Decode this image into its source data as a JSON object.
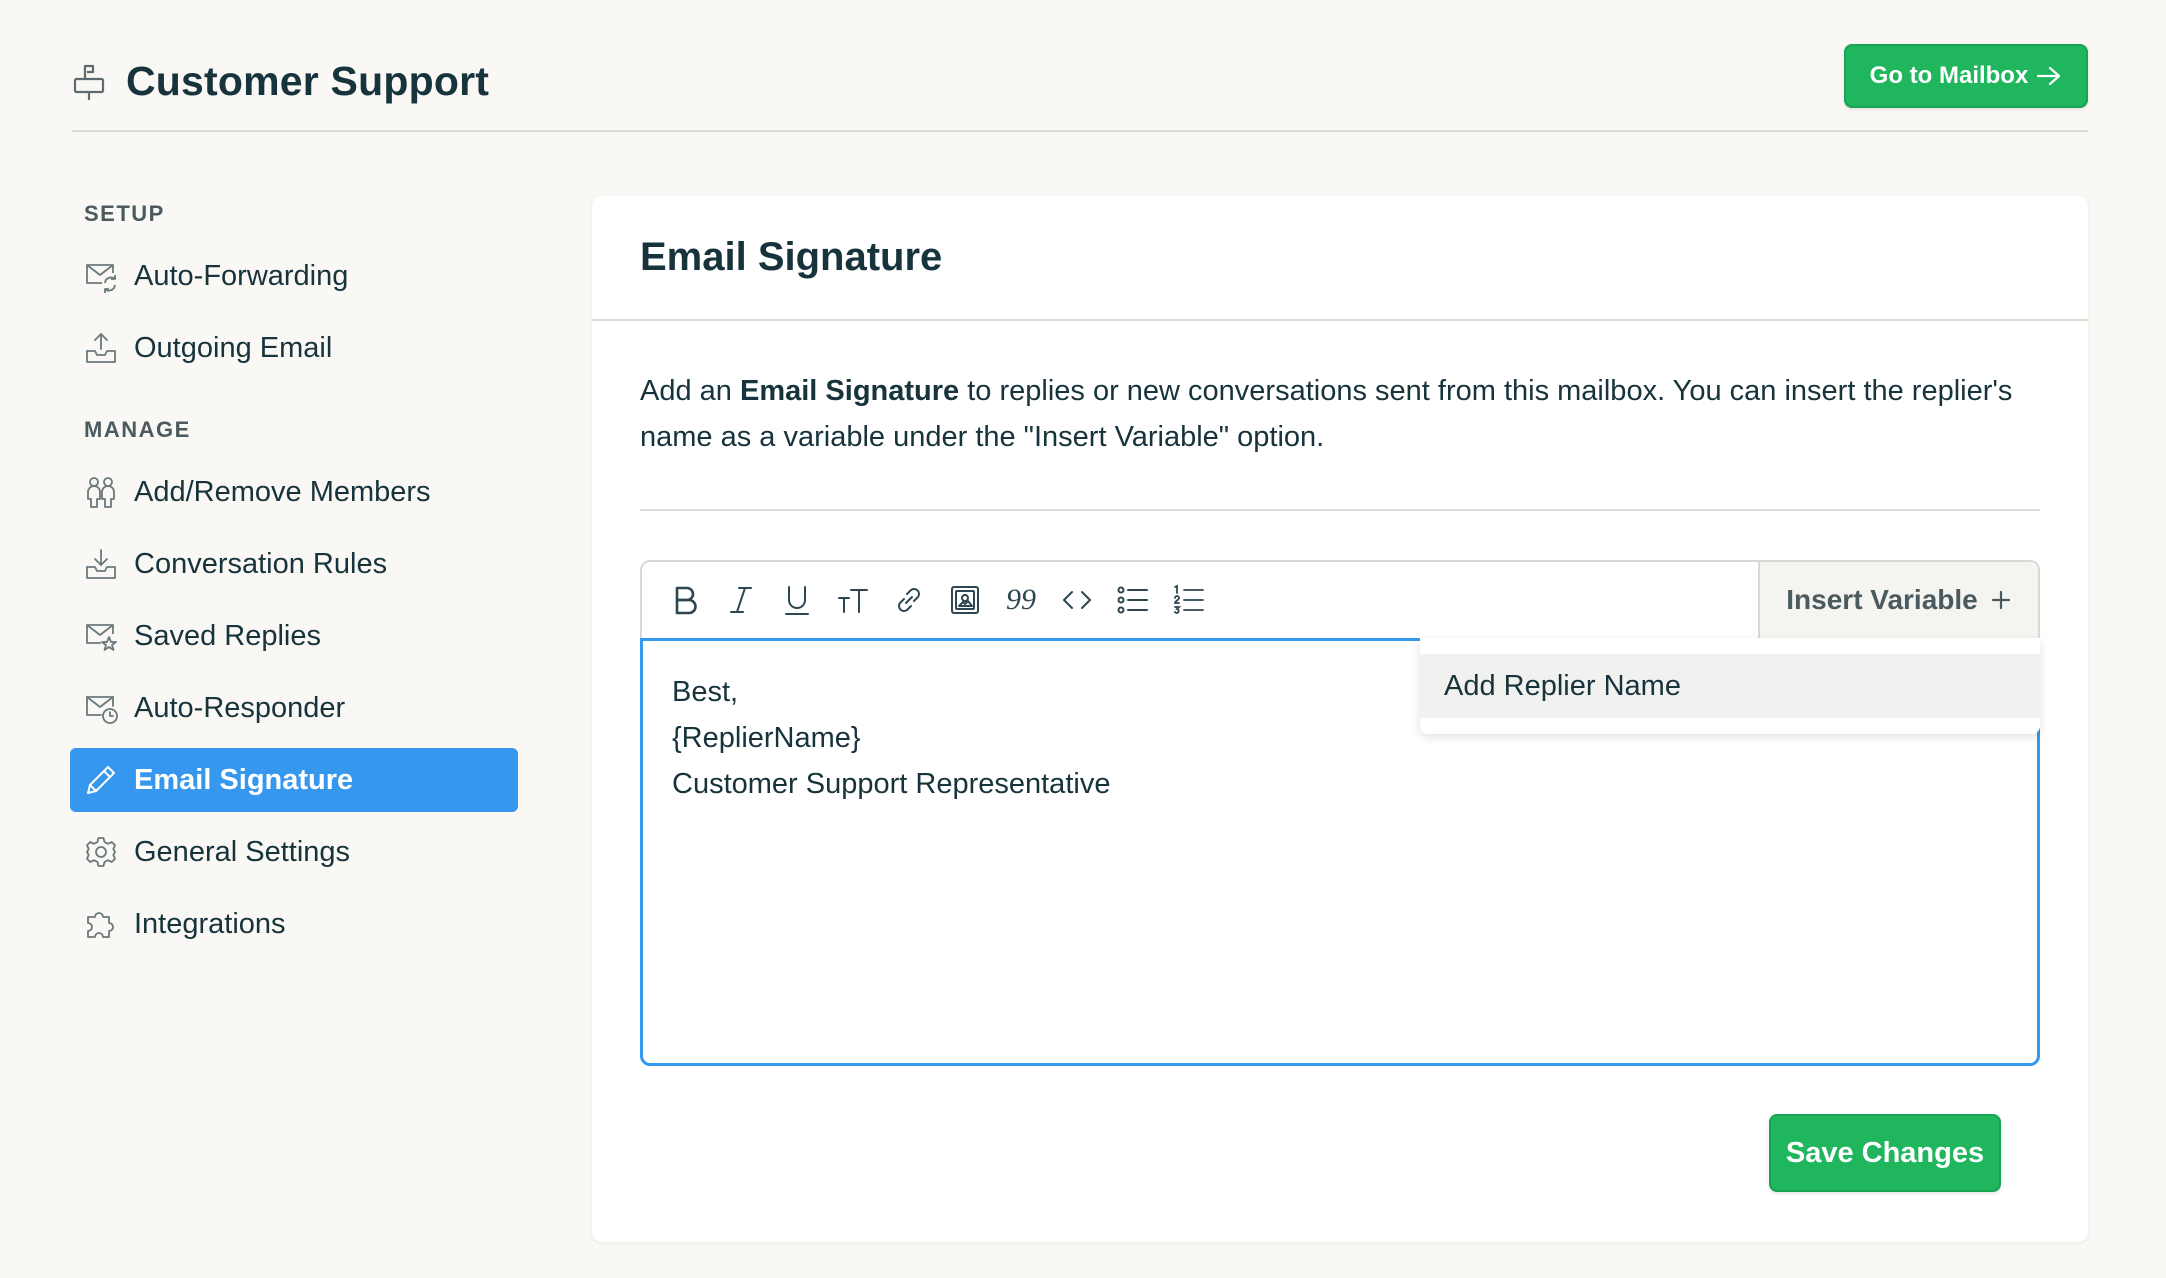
{
  "header": {
    "title": "Customer Support",
    "brand_icon": "mailbox-icon",
    "mailbox_button": "Go to Mailbox"
  },
  "sidebar": {
    "sections": [
      {
        "title": "SETUP",
        "items": [
          {
            "label": "Auto-Forwarding",
            "icon": "mail-forward-icon"
          },
          {
            "label": "Outgoing Email",
            "icon": "tray-upload-icon"
          }
        ]
      },
      {
        "title": "MANAGE",
        "items": [
          {
            "label": "Add/Remove Members",
            "icon": "members-icon"
          },
          {
            "label": "Conversation Rules",
            "icon": "tray-download-icon"
          },
          {
            "label": "Saved Replies",
            "icon": "mail-star-icon"
          },
          {
            "label": "Auto-Responder",
            "icon": "mail-clock-icon"
          },
          {
            "label": "Email Signature",
            "icon": "pencil-icon",
            "active": true
          },
          {
            "label": "General Settings",
            "icon": "gear-icon"
          },
          {
            "label": "Integrations",
            "icon": "puzzle-icon"
          }
        ]
      }
    ]
  },
  "main": {
    "title": "Email Signature",
    "description": {
      "before": "Add an ",
      "bold": "Email Signature",
      "after": " to replies or new conversations sent from this mailbox. You can insert the replier's name as a variable under the \"Insert Variable\" option."
    },
    "toolbar": {
      "tools": [
        "bold-icon",
        "italic-icon",
        "underline-icon",
        "text-size-icon",
        "link-icon",
        "image-icon",
        "quote-icon",
        "code-icon",
        "bullet-list-icon",
        "numbered-list-icon"
      ],
      "quote_glyph": "99",
      "text_size_glyph": "тТ",
      "insert_variable": "Insert Variable"
    },
    "signature_lines": [
      "Best,",
      "{ReplierName}",
      "Customer Support Representative"
    ],
    "dropdown": {
      "items": [
        "Add Replier Name"
      ]
    },
    "save_button": "Save Changes"
  },
  "colors": {
    "accent_blue": "#3597ed",
    "primary_green": "#1fb65e",
    "text_dark": "#17333b",
    "page_bg": "#f9f8f5"
  }
}
